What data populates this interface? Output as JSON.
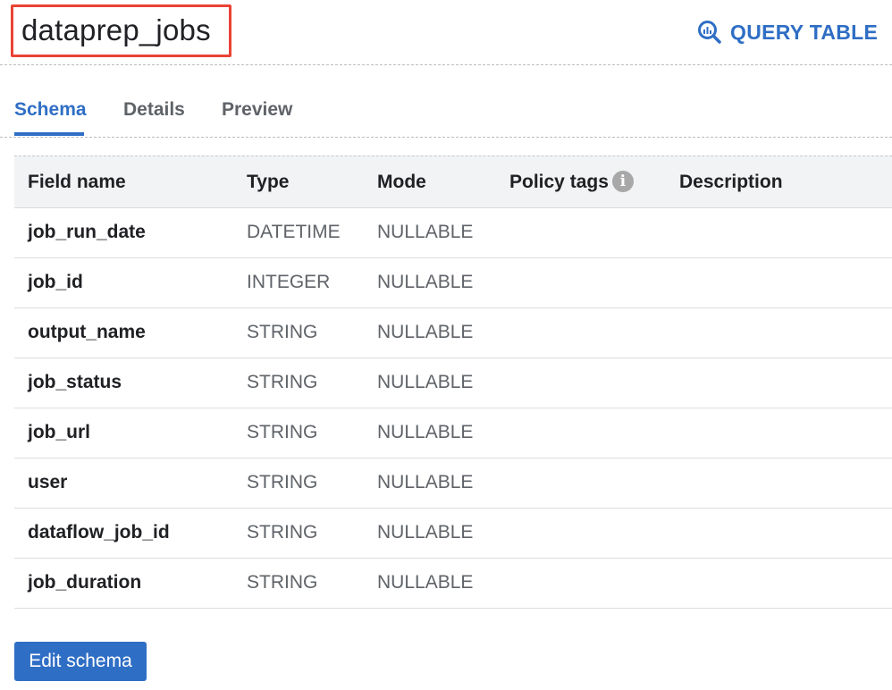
{
  "header": {
    "title": "dataprep_jobs",
    "query_button_label": "QUERY TABLE",
    "query_icon": "query-search-icon",
    "accent_color": "#2f6ec5",
    "highlight_color": "#ea4335"
  },
  "tabs": [
    {
      "label": "Schema",
      "active": true
    },
    {
      "label": "Details",
      "active": false
    },
    {
      "label": "Preview",
      "active": false
    }
  ],
  "table": {
    "headers": {
      "field_name": "Field name",
      "type": "Type",
      "mode": "Mode",
      "policy_tags": "Policy tags",
      "description": "Description"
    },
    "info_icon": "info-icon",
    "rows": [
      {
        "name": "job_run_date",
        "type": "DATETIME",
        "mode": "NULLABLE"
      },
      {
        "name": "job_id",
        "type": "INTEGER",
        "mode": "NULLABLE"
      },
      {
        "name": "output_name",
        "type": "STRING",
        "mode": "NULLABLE"
      },
      {
        "name": "job_status",
        "type": "STRING",
        "mode": "NULLABLE"
      },
      {
        "name": "job_url",
        "type": "STRING",
        "mode": "NULLABLE"
      },
      {
        "name": "user",
        "type": "STRING",
        "mode": "NULLABLE"
      },
      {
        "name": "dataflow_job_id",
        "type": "STRING",
        "mode": "NULLABLE"
      },
      {
        "name": "job_duration",
        "type": "STRING",
        "mode": "NULLABLE"
      }
    ]
  },
  "footer": {
    "edit_button_label": "Edit schema"
  }
}
